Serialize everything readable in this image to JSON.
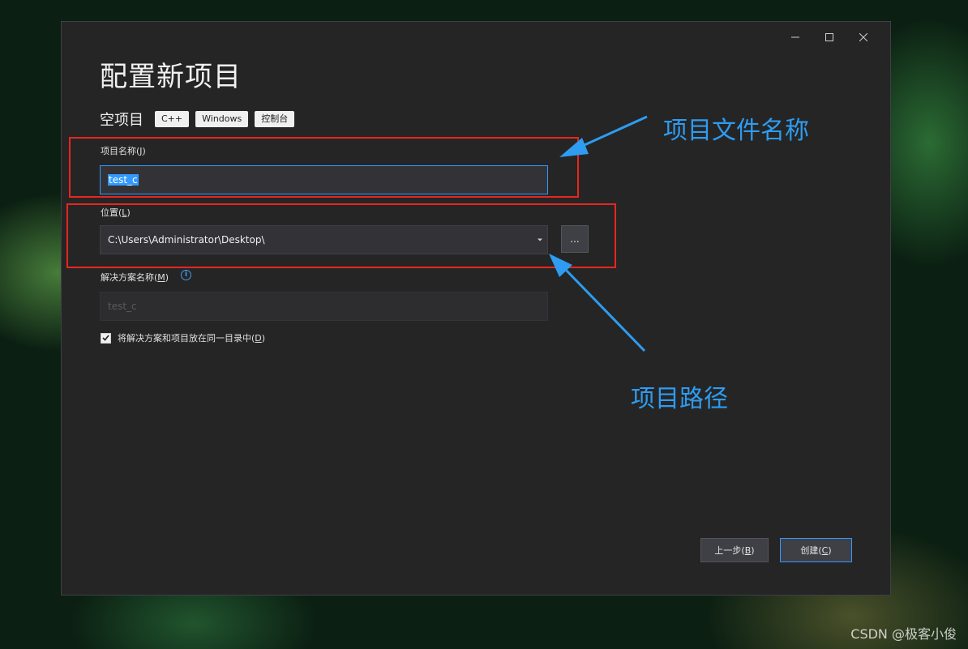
{
  "window": {
    "controls": {
      "minimize": "minimize",
      "maximize": "maximize",
      "close": "close"
    }
  },
  "header": {
    "title": "配置新项目"
  },
  "template": {
    "name": "空项目",
    "tags": [
      "C++",
      "Windows",
      "控制台"
    ]
  },
  "project_name": {
    "label": "项目名称",
    "accel": "J",
    "value": "test_c"
  },
  "location": {
    "label": "位置",
    "accel": "L",
    "value": "C:\\Users\\Administrator\\Desktop\\",
    "browse_label": "..."
  },
  "solution_name": {
    "label": "解决方案名称",
    "accel": "M",
    "value": "test_c"
  },
  "same_dir_checkbox": {
    "label": "将解决方案和项目放在同一目录中",
    "accel": "D",
    "checked": true
  },
  "footer": {
    "back_label": "上一步",
    "back_accel": "B",
    "create_label": "创建",
    "create_accel": "C"
  },
  "annotations": {
    "project_name_note": "项目文件名称",
    "location_note": "项目路径",
    "box_color": "#e8261f",
    "arrow_color": "#2e9cf0"
  },
  "watermark": "CSDN @极客小俊"
}
